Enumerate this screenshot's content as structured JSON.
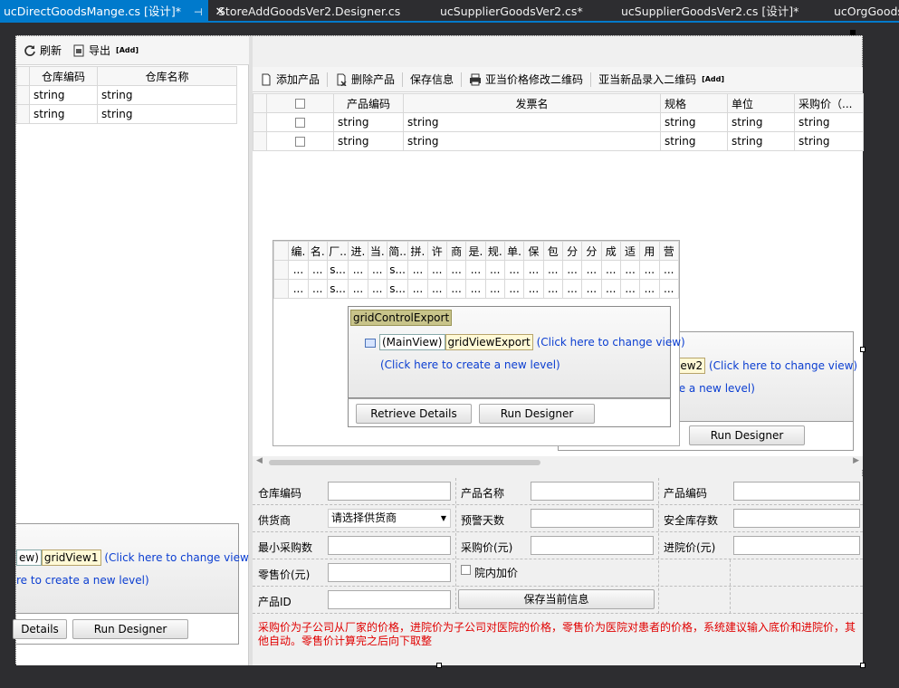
{
  "tabs": [
    {
      "label": "ucDirectGoodsMange.cs [设计]*",
      "active": true
    },
    {
      "label": "StoreAddGoodsVer2.Designer.cs",
      "active": false
    },
    {
      "label": "ucSupplierGoodsVer2.cs*",
      "active": false
    },
    {
      "label": "ucSupplierGoodsVer2.cs [设计]*",
      "active": false
    },
    {
      "label": "ucOrgGoods",
      "active": false
    }
  ],
  "left_toolbar": {
    "refresh": "刷新",
    "export": "导出",
    "add_tag": "[Add]"
  },
  "left_grid": {
    "columns": [
      "仓库编码",
      "仓库名称"
    ],
    "rows": [
      [
        "string",
        "string"
      ],
      [
        "string",
        "string"
      ]
    ]
  },
  "left_designer": {
    "view_partial": "ew)",
    "view_name": "gridView1",
    "change_view": "(Click here to change view)",
    "new_level": "re to create a new level)",
    "retrieve": "Details",
    "run_designer": "Run Designer"
  },
  "right_toolbar": {
    "add": "添加产品",
    "delete": "删除产品",
    "save": "保存信息",
    "price_qr": "亚当价格修改二维码",
    "new_qr": "亚当新品录入二维码",
    "add_tag": "[Add]"
  },
  "product_grid": {
    "columns": [
      "产品编码",
      "发票名",
      "规格",
      "单位",
      "采购价（..."
    ],
    "rows": [
      [
        "string",
        "string",
        "string",
        "string",
        "string"
      ],
      [
        "string",
        "string",
        "string",
        "string",
        "string"
      ]
    ]
  },
  "export_grid": {
    "columns": [
      "编.",
      "名.",
      "厂..",
      "进.",
      "当.",
      "简..",
      "拼.",
      "许",
      "商",
      "是.",
      "规.",
      "单.",
      "保",
      "包",
      "分",
      "分",
      "成",
      "适",
      "用",
      "营"
    ],
    "row1": [
      "...",
      "...",
      "s...",
      "...",
      "...",
      "s...",
      "...",
      "...",
      "...",
      "...",
      "...",
      "...",
      "...",
      "...",
      "...",
      "...",
      "...",
      "...",
      "...",
      "..."
    ],
    "row2": [
      "...",
      "...",
      "s...",
      "...",
      "...",
      "s...",
      "...",
      "...",
      "...",
      "...",
      "...",
      "...",
      "...",
      "...",
      "...",
      "...",
      "...",
      "...",
      "...",
      "..."
    ]
  },
  "export_designer": {
    "control": "gridControlExport",
    "main_view": "(MainView)",
    "view_name": "gridViewExport",
    "change_view": "(Click here to change view)",
    "new_level": "(Click here to create a new level)",
    "retrieve": "Retrieve Details",
    "run_designer": "Run Designer"
  },
  "back_designer": {
    "view_partial": "iew2",
    "change_view": "(Click here to change view)",
    "new_level": "te a new level)",
    "run_designer": "Run Designer"
  },
  "form": {
    "warehouse_code": "仓库编码",
    "product_name": "产品名称",
    "product_code": "产品编码",
    "supplier": "供货商",
    "supplier_value": "请选择供货商",
    "warning_days": "预警天数",
    "safe_stock": "安全库存数",
    "min_purchase": "最小采购数",
    "purchase_price": "采购价(元)",
    "stock_price": "进院价(元)",
    "retail_price": "零售价(元)",
    "in_hospital_markup": "院内加价",
    "product_id": "产品ID",
    "save_current": "保存当前信息"
  },
  "note": "采购价为子公司从厂家的价格，进院价为子公司对医院的价格，零售价为医院对患者的价格，系统建议输入底价和进院价，其他自动。零售价计算完之后向下取整"
}
